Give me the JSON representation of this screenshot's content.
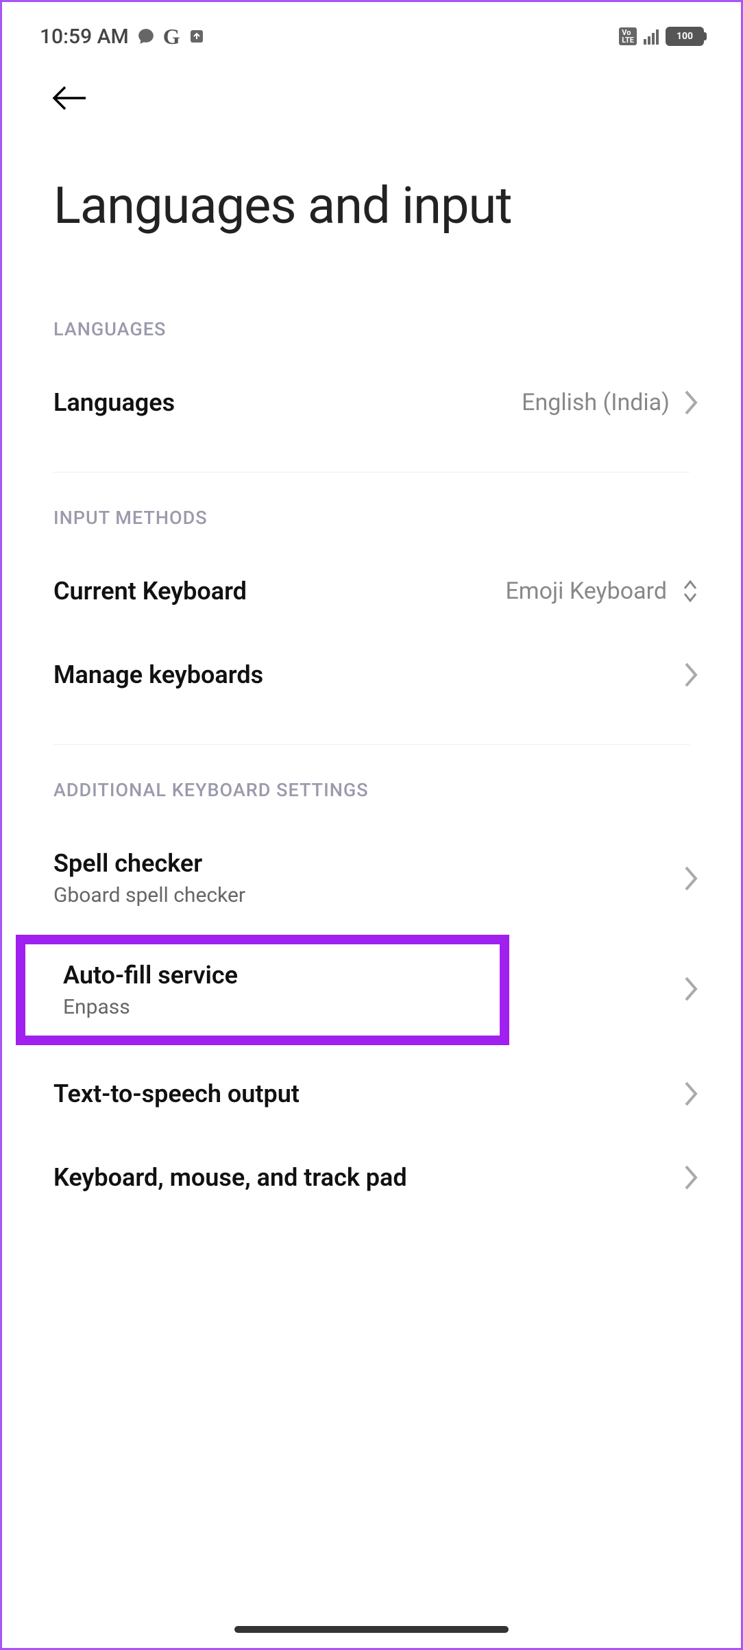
{
  "status_bar": {
    "time": "10:59 AM",
    "battery_pct": "100",
    "volte": "Vo\nLTE"
  },
  "header": {
    "title": "Languages and input"
  },
  "sections": {
    "languages": {
      "header": "LANGUAGES",
      "items": {
        "languages": {
          "label": "Languages",
          "value": "English (India)"
        }
      }
    },
    "input_methods": {
      "header": "INPUT METHODS",
      "items": {
        "current_keyboard": {
          "label": "Current Keyboard",
          "value": "Emoji Keyboard"
        },
        "manage_keyboards": {
          "label": "Manage keyboards"
        }
      }
    },
    "additional": {
      "header": "ADDITIONAL KEYBOARD SETTINGS",
      "items": {
        "spell_checker": {
          "label": "Spell checker",
          "sublabel": "Gboard spell checker"
        },
        "autofill": {
          "label": "Auto-fill service",
          "sublabel": "Enpass"
        },
        "tts": {
          "label": "Text-to-speech output"
        },
        "kmt": {
          "label": "Keyboard, mouse, and track pad"
        }
      }
    }
  }
}
